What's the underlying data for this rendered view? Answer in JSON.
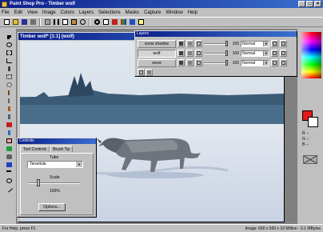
{
  "window": {
    "title": "Paint Shop Pro - Timber wolf"
  },
  "menu": [
    "File",
    "Edit",
    "View",
    "Image",
    "Colors",
    "Layers",
    "Selections",
    "Masks",
    "Capture",
    "Window",
    "Help"
  ],
  "toolbar": {
    "icons": [
      "new-icon",
      "open-icon",
      "save-icon",
      "print-icon",
      "scan-icon",
      "cut-icon",
      "copy-icon",
      "paste-icon",
      "undo-icon",
      "zoom-icon",
      "fullscreen-icon",
      "toggle-palettes-icon",
      "histogram-icon",
      "layers-icon",
      "help-icon"
    ]
  },
  "toolbox": {
    "tools": [
      "arrow-tool-icon",
      "zoom-tool-icon",
      "deformation-tool-icon",
      "crop-tool-icon",
      "mover-tool-icon",
      "selection-tool-icon",
      "freehand-tool-icon",
      "magic-wand-icon",
      "dropper-tool-icon",
      "paintbrush-tool-icon",
      "clone-brush-icon",
      "color-replacer-icon",
      "retouch-tool-icon",
      "eraser-tool-icon",
      "picture-tube-icon",
      "airbrush-tool-icon",
      "flood-fill-icon",
      "text-tool-icon",
      "shape-tool-icon",
      "line-tool-icon"
    ]
  },
  "image_window": {
    "title": "Timber wolf* [1:1] (wolf)"
  },
  "layers": {
    "title": "Layers",
    "rows": [
      {
        "name": "snow shadow",
        "opacity": "100",
        "blend": "Normal",
        "selected": false
      },
      {
        "name": "wolf",
        "opacity": "100",
        "blend": "Normal",
        "selected": true
      },
      {
        "name": "snow",
        "opacity": "100",
        "blend": "Normal",
        "selected": false
      }
    ]
  },
  "controls": {
    "title": "Controls",
    "tabs": [
      "Tool Controls",
      "Brush Tip"
    ],
    "tube_label": "Tube",
    "tube_value": "Tarantula",
    "scale_label": "Scale",
    "scale_value": "100%",
    "options_label": "Options..."
  },
  "colors": {
    "fg": "#e51b1b",
    "bg": "#ffffff",
    "r_label": "R --",
    "g_label": "G --",
    "b_label": "B --"
  },
  "status": {
    "left": "For Help, press F1",
    "right": "Image:  660 x 500 x 16 Million - 0.1 MBytes"
  }
}
